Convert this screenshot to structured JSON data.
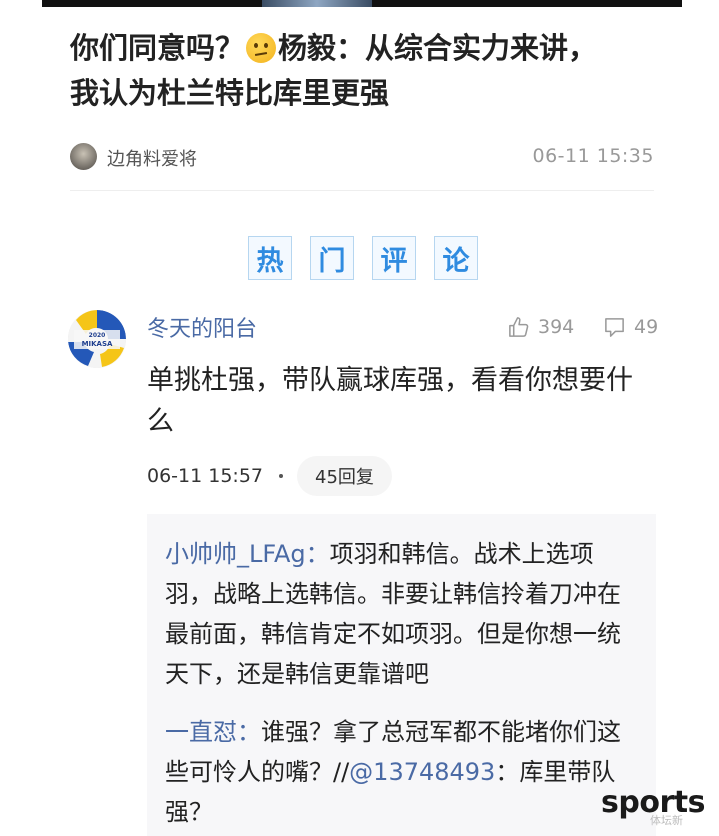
{
  "article": {
    "title_line1_part1": "你们同意吗？",
    "title_line1_part2": "杨毅：从综合实力来讲，",
    "title_line2": "我认为杜兰特比库里更强",
    "emoji_icon": "thinking-face-icon",
    "author_name": "边角料爱将",
    "post_time": "06-11 15:35"
  },
  "hot_comments_heading": [
    "热",
    "门",
    "评",
    "论"
  ],
  "comment": {
    "user": "冬天的阳台",
    "likes": "394",
    "replies_count_icon": "49",
    "text": "单挑杜强，带队赢球库强，看看你想要什么",
    "time": "06-11 15:57",
    "reply_button": "45回复",
    "avatar_ball_text": "2020",
    "avatar_brand_text": "MIKASA"
  },
  "replies": [
    {
      "user": "小帅帅_LFAg",
      "sep": "：",
      "text": "项羽和韩信。战术上选项羽，战略上选韩信。非要让韩信拎着刀冲在最前面，韩信肯定不如项羽。但是你想一统天下，还是韩信更靠谱吧"
    },
    {
      "user": "一直怼",
      "sep": "：",
      "text_before": "谁强？拿了总冠军都不能堵你们这些可怜人的嘴？//",
      "mention": "@13748493",
      "text_after": "：库里带队强？"
    }
  ],
  "watermark": {
    "main": "sports",
    "sub": "体坛新"
  },
  "colors": {
    "link": "#4a6aa5",
    "hot_heading": "#2f8be0",
    "muted": "#999999"
  }
}
